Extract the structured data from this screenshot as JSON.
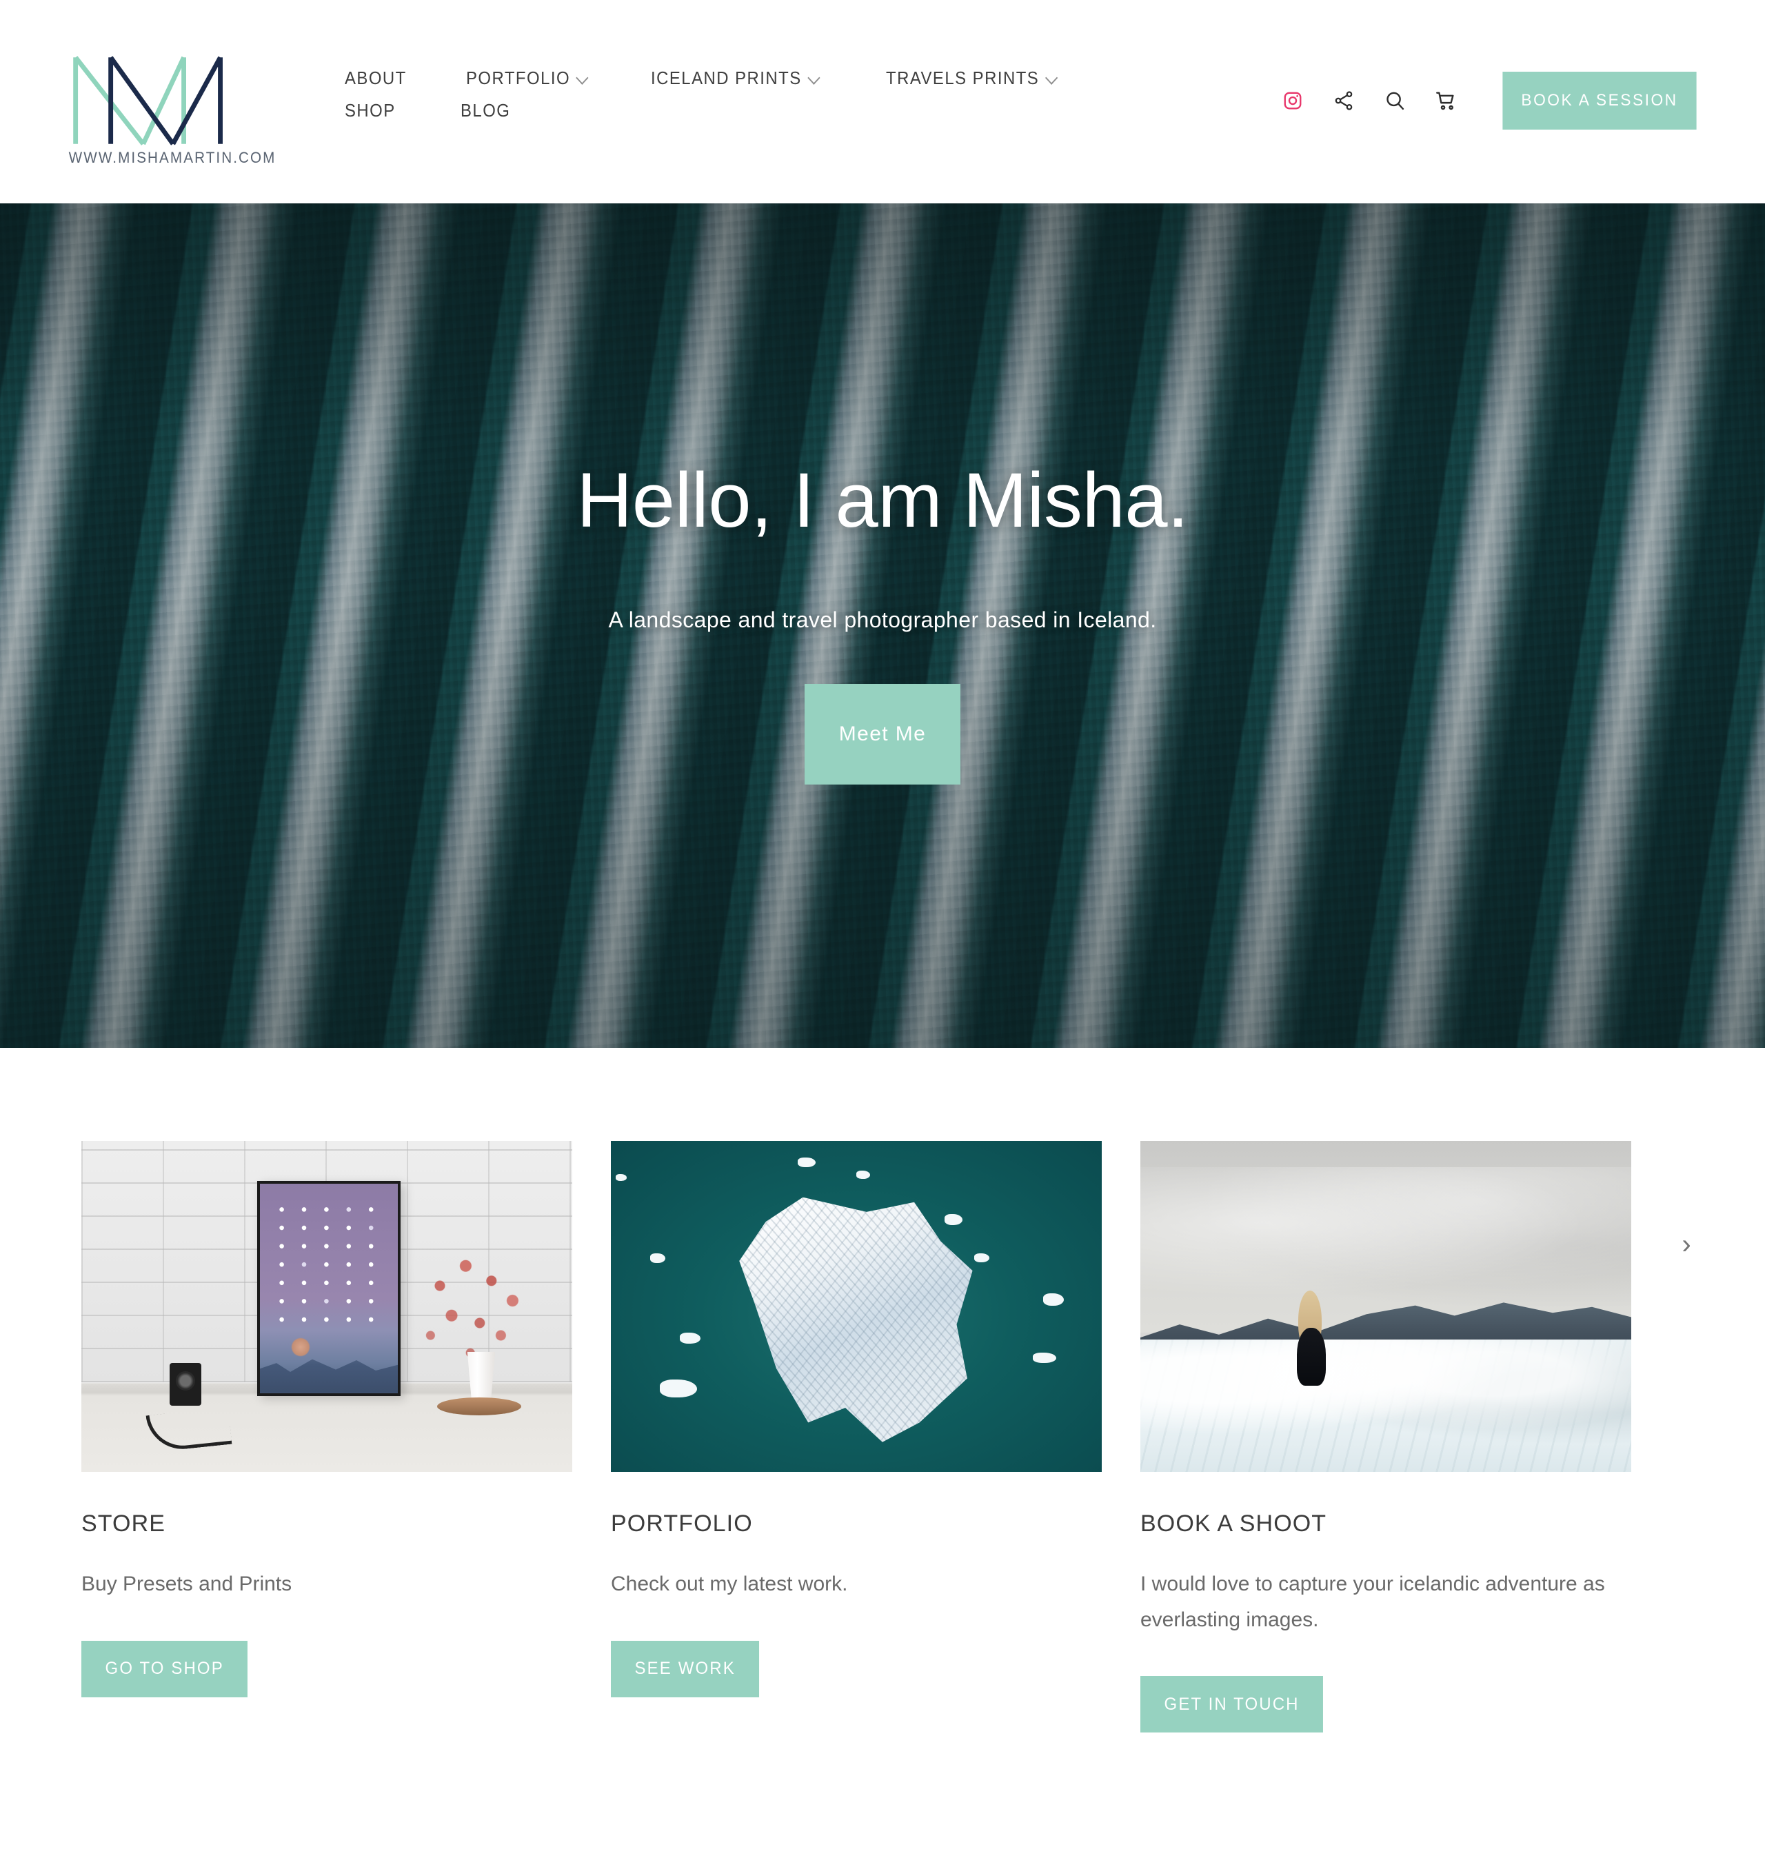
{
  "brand": {
    "logo_alt": "misha-martin-monogram",
    "url_text": "WWW.MISHAMARTIN.COM",
    "mint": "#96d2c0",
    "navy": "#1b2a4a",
    "instagram_pink": "#e8376b"
  },
  "nav": {
    "row1": [
      {
        "label": "ABOUT",
        "has_dropdown": false
      },
      {
        "label": "PORTFOLIO",
        "has_dropdown": true
      },
      {
        "label": "ICELAND PRINTS",
        "has_dropdown": true
      },
      {
        "label": "TRAVELS PRINTS",
        "has_dropdown": true
      }
    ],
    "row2": [
      {
        "label": "SHOP",
        "has_dropdown": false
      },
      {
        "label": "BLOG",
        "has_dropdown": false
      }
    ]
  },
  "header_actions": {
    "icons": [
      "instagram-icon",
      "share-icon",
      "search-icon",
      "cart-icon"
    ],
    "book_label": "BOOK A SESSION"
  },
  "hero": {
    "title": "Hello, I am Misha.",
    "subtitle": "A landscape and travel photographer based in Iceland.",
    "cta_label": "Meet Me",
    "image_alt": "aerial-glacier-crevasses"
  },
  "cards": [
    {
      "image_alt": "moon-calendar-print-on-brick-wall",
      "title": "STORE",
      "description": "Buy Presets and Prints",
      "cta_label": "GO TO SHOP"
    },
    {
      "image_alt": "aerial-iceberg-in-teal-water",
      "title": "PORTFOLIO",
      "description": "Check out my latest work.",
      "cta_label": "SEE WORK"
    },
    {
      "image_alt": "woman-sitting-on-glacier-ice",
      "title": "BOOK A SHOOT",
      "description": "I would love to capture your icelandic adventure as everlasting images.",
      "cta_label": "GET IN TOUCH"
    }
  ],
  "carousel": {
    "next_glyph": "›"
  }
}
